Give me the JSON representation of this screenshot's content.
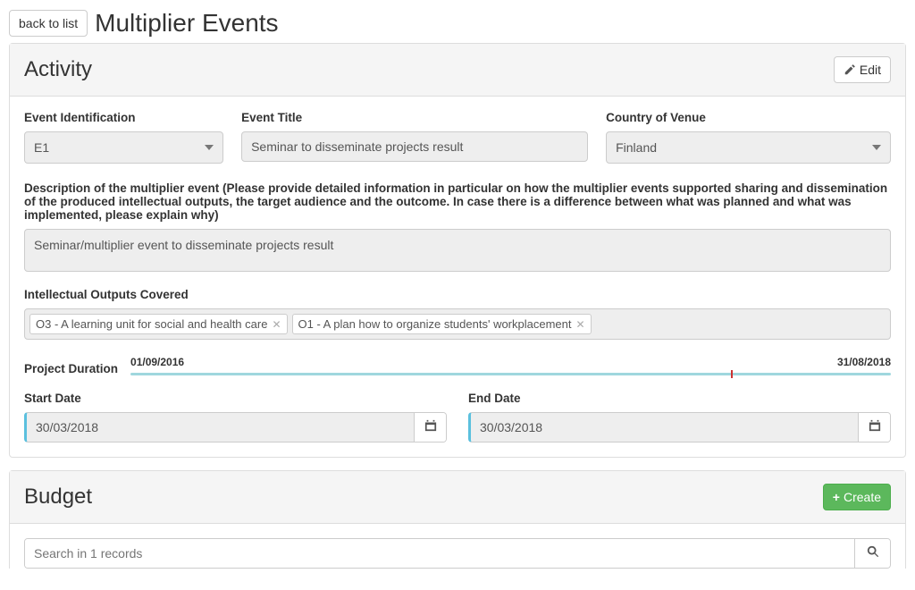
{
  "header": {
    "back_label": "back to list",
    "page_title": "Multiplier Events"
  },
  "activity": {
    "panel_title": "Activity",
    "edit_label": "Edit",
    "event_id": {
      "label": "Event Identification",
      "value": "E1"
    },
    "event_title": {
      "label": "Event Title",
      "value": "Seminar to disseminate projects result"
    },
    "country": {
      "label": "Country of Venue",
      "value": "Finland"
    },
    "description": {
      "label": "Description of the multiplier event (Please provide detailed information in particular on how the multiplier events supported sharing and dissemination of the produced intellectual outputs, the target audience and the outcome. In case there is a difference between what was planned and what was implemented, please explain why)",
      "value": "Seminar/multiplier event to disseminate projects result"
    },
    "outputs": {
      "label": "Intellectual Outputs Covered",
      "tags": [
        "O3 - A learning unit for social and health care",
        "O1 - A plan how to organize students' workplacement"
      ]
    },
    "duration": {
      "label": "Project Duration",
      "start": "01/09/2016",
      "end": "31/08/2018"
    },
    "start_date": {
      "label": "Start Date",
      "value": "30/03/2018"
    },
    "end_date": {
      "label": "End Date",
      "value": "30/03/2018"
    }
  },
  "budget": {
    "panel_title": "Budget",
    "create_label": "Create",
    "search_placeholder": "Search in 1 records"
  }
}
